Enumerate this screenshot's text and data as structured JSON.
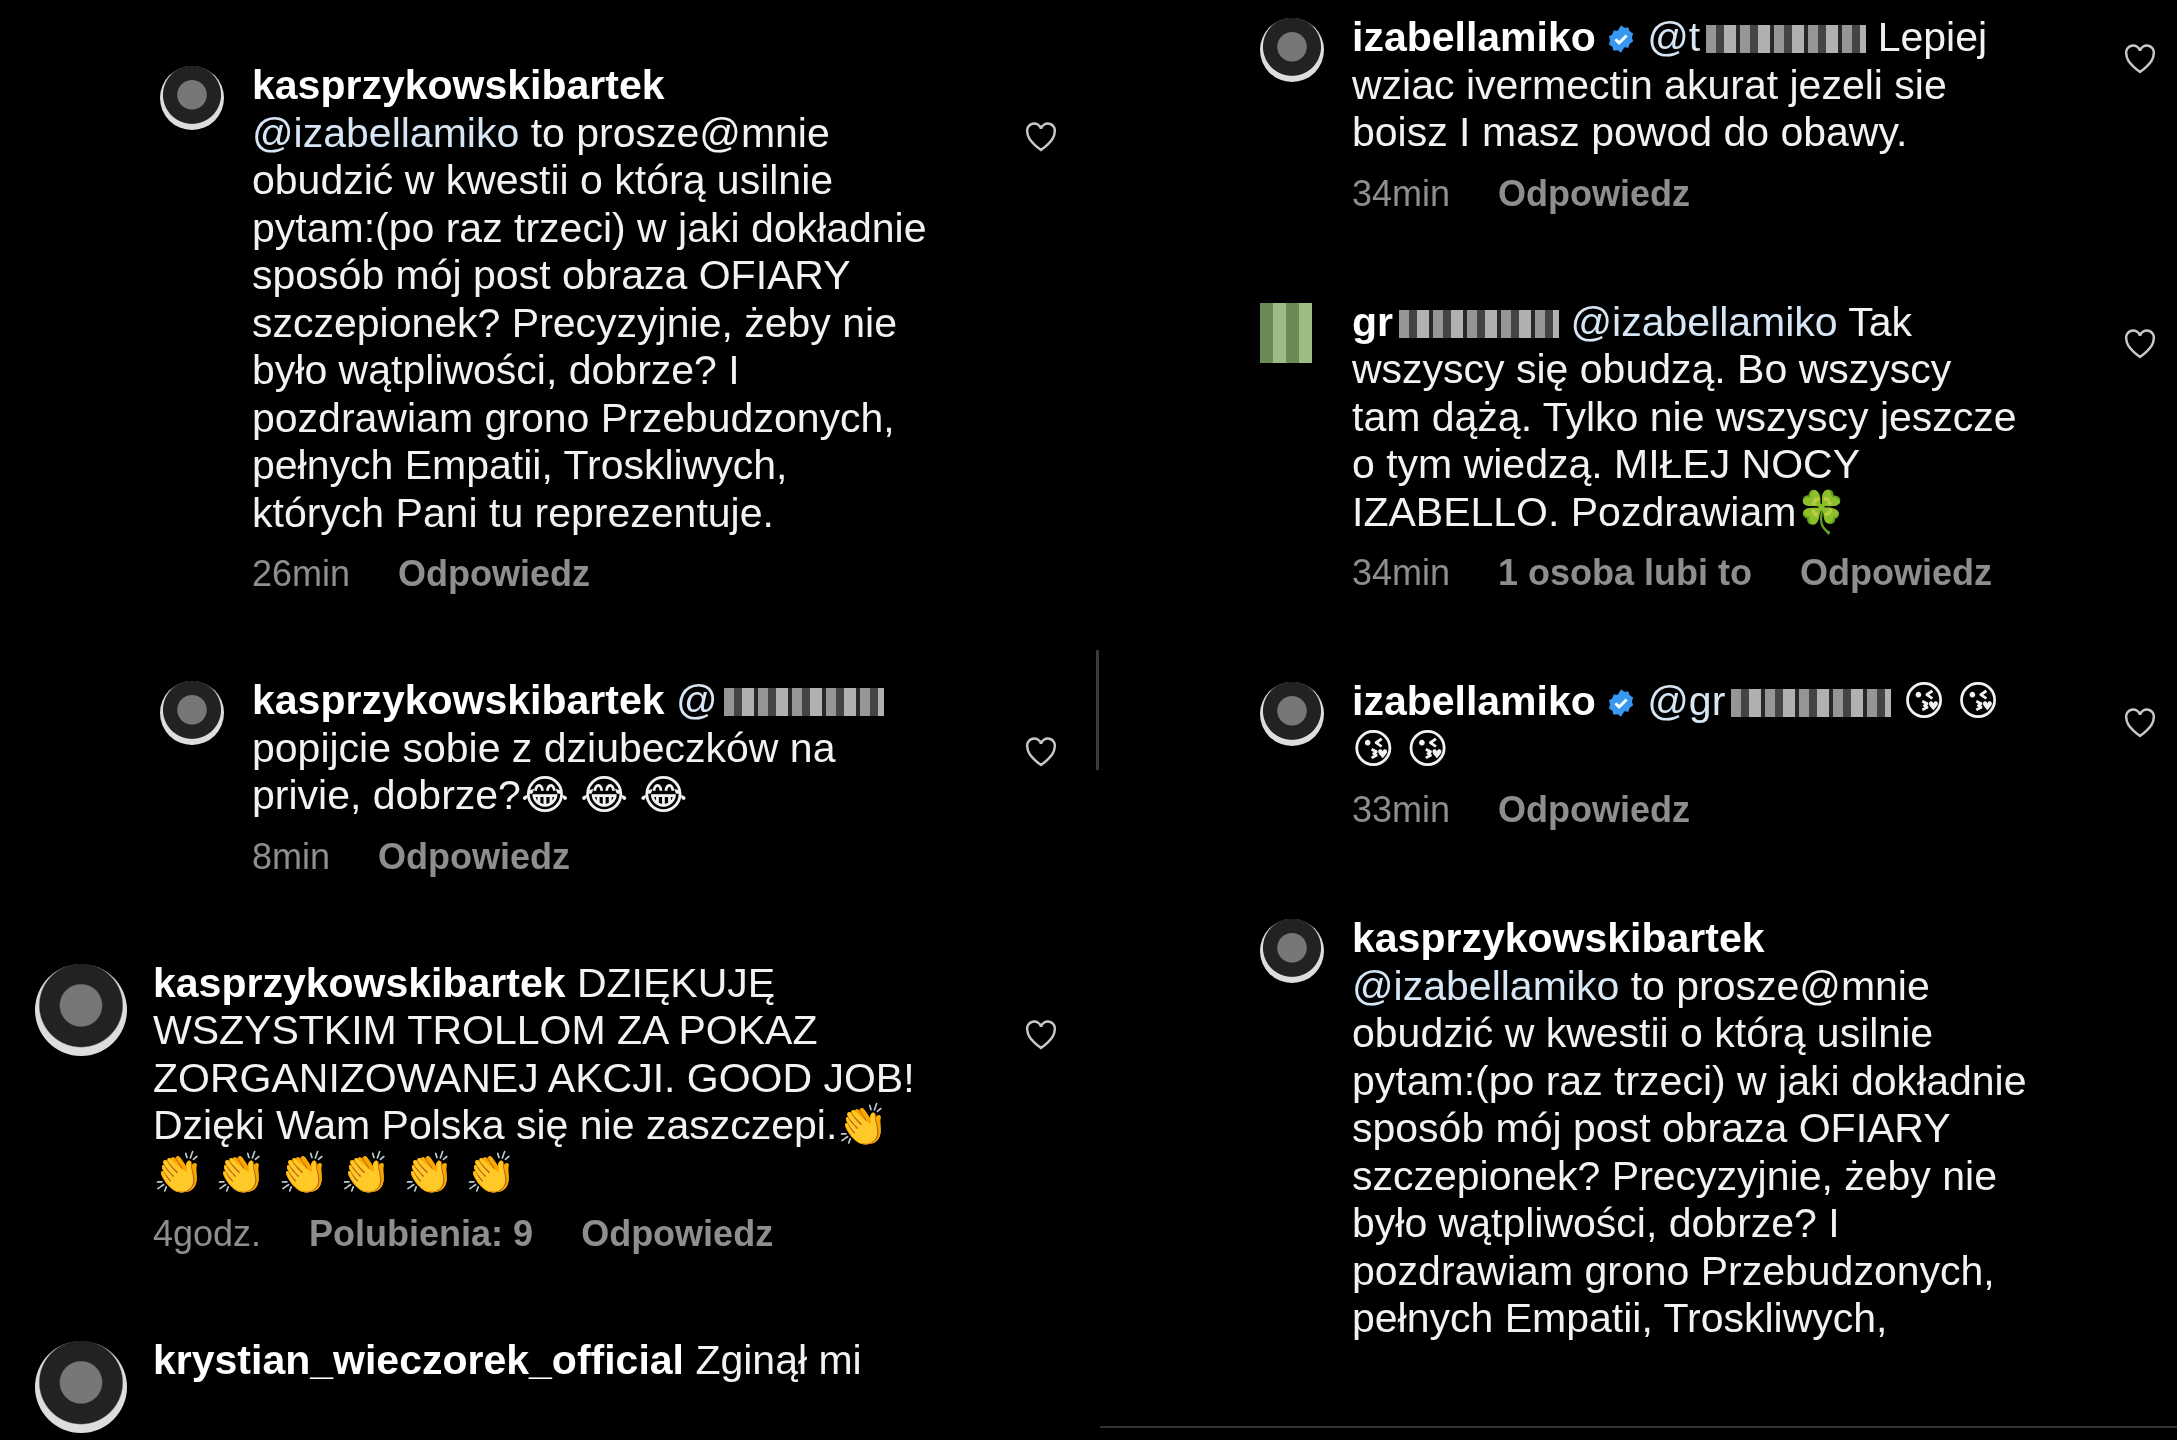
{
  "columns": [
    {
      "comments": [
        {
          "reply": true,
          "avatar": {
            "kind": "photo"
          },
          "author": {
            "text": "kasprzykowskibartek",
            "verified": false,
            "redacted": false
          },
          "segments": [
            {
              "kind": "mention",
              "text": "@izabellamiko",
              "redacted": false
            },
            {
              "kind": "text",
              "text": " to prosze@mnie obudzić w kwestii o którą usilnie pytam:(po raz trzeci) w jaki dokładnie sposób mój post obraza OFIARY szczepionek? Precyzyjnie, żeby nie było wątpliwości, dobrze? I pozdrawiam grono Przebudzonych, pełnych Empatii, Troskliwych, których Pani tu reprezentuje."
            }
          ],
          "meta": {
            "time": "26min",
            "reply": "Odpowiedz"
          }
        },
        {
          "reply": true,
          "avatar": {
            "kind": "photo"
          },
          "author": {
            "text": "kasprzykowskibartek",
            "verified": false,
            "redacted": false
          },
          "segments": [
            {
              "kind": "mention",
              "text": "@",
              "redacted": true
            },
            {
              "kind": "text",
              "text": " popijcie sobie z dziubeczków na privie, dobrze?😂 😂 😂"
            }
          ],
          "meta": {
            "time": "8min",
            "reply": "Odpowiedz"
          }
        },
        {
          "reply": false,
          "avatar": {
            "kind": "photo"
          },
          "author": {
            "text": "kasprzykowskibartek",
            "verified": false,
            "redacted": false
          },
          "segments": [
            {
              "kind": "text",
              "text": " DZIĘKUJĘ WSZYSTKIM TROLLOM ZA POKAZ ZORGANIZOWANEJ AKCJI. GOOD JOB! Dzięki Wam Polska się nie zaszczepi.👏 👏 👏 👏 👏 👏 👏"
            }
          ],
          "meta": {
            "time": "4godz.",
            "likes": "Polubienia: 9",
            "reply": "Odpowiedz"
          }
        },
        {
          "reply": false,
          "avatar": {
            "kind": "photo"
          },
          "author": {
            "text": "krystian_wieczorek_official",
            "verified": false,
            "redacted": false
          },
          "segments": [
            {
              "kind": "text",
              "text": " Zginął mi"
            }
          ]
        }
      ]
    },
    {
      "comments": [
        {
          "reply": true,
          "avatar": {
            "kind": "photo"
          },
          "author": {
            "text": "izabellamiko",
            "verified": true,
            "redacted": false
          },
          "segments": [
            {
              "kind": "mention",
              "text": "@t",
              "redacted": true
            },
            {
              "kind": "text",
              "text": " Lepiej wziac ivermectin akurat jezeli sie boisz I masz powod do obawy."
            }
          ],
          "meta": {
            "time": "34min",
            "reply": "Odpowiedz"
          }
        },
        {
          "reply": true,
          "avatar": {
            "kind": "pixelated"
          },
          "author": {
            "text": "gr",
            "verified": false,
            "redacted": true
          },
          "segments": [
            {
              "kind": "mention",
              "text": "@izabellamiko",
              "redacted": false
            },
            {
              "kind": "text",
              "text": " Tak wszyscy się obudzą. Bo wszyscy tam dążą. Tylko nie wszyscy jeszcze o tym wiedzą. MIŁEJ NOCY IZABELLO. Pozdrawiam🍀"
            }
          ],
          "meta": {
            "time": "34min",
            "likes": "1 osoba lubi to",
            "reply": "Odpowiedz"
          }
        },
        {
          "reply": true,
          "avatar": {
            "kind": "photo"
          },
          "author": {
            "text": "izabellamiko",
            "verified": true,
            "redacted": false
          },
          "segments": [
            {
              "kind": "mention",
              "text": "@gr",
              "redacted": true
            },
            {
              "kind": "text",
              "text": " 😘 😘 😘 😘"
            }
          ],
          "meta": {
            "time": "33min",
            "reply": "Odpowiedz"
          }
        },
        {
          "reply": true,
          "avatar": {
            "kind": "photo"
          },
          "author": {
            "text": "kasprzykowskibartek",
            "verified": false,
            "redacted": false
          },
          "segments": [
            {
              "kind": "mention",
              "text": "@izabellamiko",
              "redacted": false
            },
            {
              "kind": "text",
              "text": " to prosze@mnie obudzić w kwestii o którą usilnie pytam:(po raz trzeci) w jaki dokładnie sposób mój post obraza OFIARY szczepionek? Precyzyjnie, żeby nie było wątpliwości, dobrze? I pozdrawiam grono Przebudzonych, pełnych Empatii, Troskliwych,"
            }
          ]
        }
      ]
    }
  ]
}
